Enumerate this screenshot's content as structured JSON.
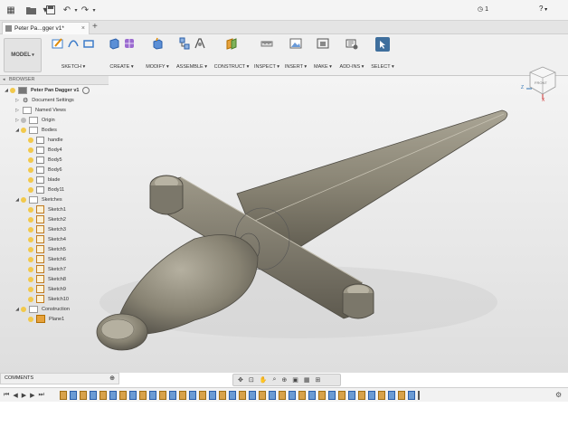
{
  "titlebar": {
    "clock_count": "1",
    "help_label": "?"
  },
  "tab": {
    "title": "Peter Pa...gger v1*"
  },
  "toolbar": {
    "mode": "MODEL",
    "groups": [
      "SKETCH",
      "CREATE",
      "MODIFY",
      "ASSEMBLE",
      "CONSTRUCT",
      "INSPECT",
      "INSERT",
      "MAKE",
      "ADD-INS",
      "SELECT"
    ]
  },
  "browser": {
    "header": "BROWSER",
    "root": "Peter Pan Dagger v1",
    "items": {
      "document_settings": "Document Settings",
      "named_views": "Named Views",
      "origin": "Origin",
      "bodies": "Bodies",
      "sketches": "Sketches",
      "construction": "Construction"
    },
    "bodies": [
      "handle",
      "Body4",
      "Body5",
      "Body6",
      "blade",
      "Body11"
    ],
    "sketches": [
      "Sketch1",
      "Sketch2",
      "Sketch3",
      "Sketch4",
      "Sketch5",
      "Sketch6",
      "Sketch7",
      "Sketch8",
      "Sketch9",
      "Sketch10"
    ],
    "construction_items": [
      "Plane1"
    ]
  },
  "comments": {
    "label": "COMMENTS"
  },
  "viewcube": {
    "face": "FRONT",
    "axis_z": "Z",
    "axis_x": "X"
  },
  "colors": {
    "accent": "#2a6fb0",
    "select_active": "#3f6f9d",
    "body": "#8c8778"
  }
}
